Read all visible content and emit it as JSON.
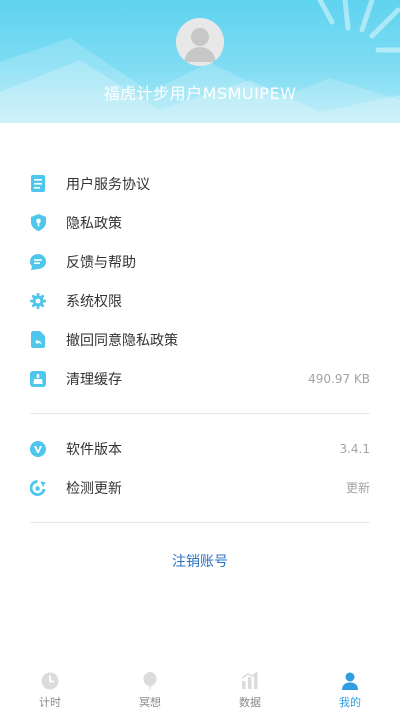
{
  "header": {
    "user_name": "福虎计步用户MSMUIPEW"
  },
  "menu": {
    "group1": [
      {
        "label": "用户服务协议",
        "icon": "document-icon"
      },
      {
        "label": "隐私政策",
        "icon": "privacy-shield-icon"
      },
      {
        "label": "反馈与帮助",
        "icon": "feedback-chat-icon"
      },
      {
        "label": "系统权限",
        "icon": "gear-icon"
      },
      {
        "label": "撤回同意隐私政策",
        "icon": "revoke-document-icon"
      },
      {
        "label": "清理缓存",
        "icon": "broom-icon",
        "value": "490.97 KB"
      }
    ],
    "group2": [
      {
        "label": "软件版本",
        "icon": "version-icon",
        "value": "3.4.1"
      },
      {
        "label": "检测更新",
        "icon": "refresh-icon",
        "value": "更新"
      }
    ]
  },
  "logout": {
    "label": "注销账号"
  },
  "tabbar": {
    "tabs": [
      {
        "label": "计时",
        "icon": "clock-icon",
        "active": false
      },
      {
        "label": "冥想",
        "icon": "balloon-icon",
        "active": false
      },
      {
        "label": "数据",
        "icon": "bar-chart-icon",
        "active": false
      },
      {
        "label": "我的",
        "icon": "person-icon",
        "active": true
      }
    ]
  },
  "colors": {
    "header_top": "#5fd3ef",
    "icon_accent": "#4fc6ec",
    "logout_text": "#2a73c4",
    "tab_active": "#2f9ee0",
    "tab_inactive": "#8a8a8a"
  }
}
